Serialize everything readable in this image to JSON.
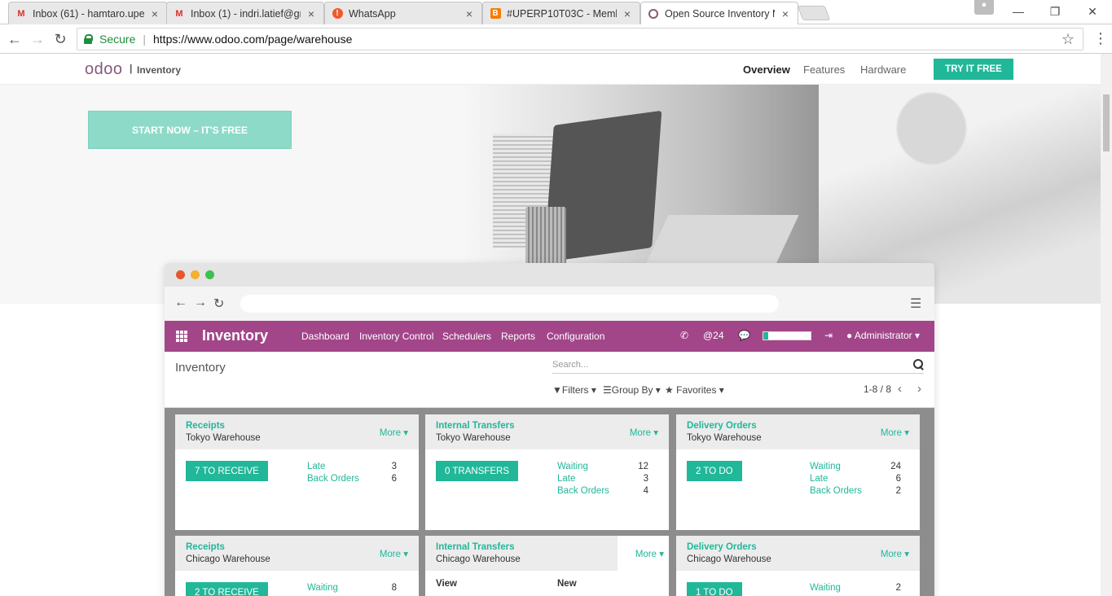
{
  "tabs": [
    {
      "title": "Inbox (61) - hamtaro.upe",
      "icon": "gmail-icon"
    },
    {
      "title": "Inbox (1) - indri.latief@gr",
      "icon": "gmail-icon"
    },
    {
      "title": "WhatsApp",
      "icon": "whatsapp-icon"
    },
    {
      "title": "#UPERP10T03C - Memb",
      "icon": "blogger-icon"
    },
    {
      "title": "Open Source Inventory M",
      "icon": "odoo-icon"
    }
  ],
  "address": {
    "secure_label": "Secure",
    "url": "https://www.odoo.com/page/warehouse"
  },
  "site": {
    "logo": "odoo",
    "app_sep": "|",
    "app": "Inventory",
    "nav": [
      "Overview",
      "Features",
      "Hardware"
    ],
    "try_label": "TRY IT FREE",
    "start_label": "START NOW – IT'S FREE"
  },
  "odoo": {
    "brand": "Inventory",
    "menu": [
      "Dashboard",
      "Inventory Control",
      "Schedulers",
      "Reports",
      "Configuration"
    ],
    "mentions": "@24",
    "user": "Administrator",
    "progress": 0.1,
    "view_title": "Inventory",
    "search_placeholder": "Search...",
    "filters": "Filters",
    "group_by": "Group By",
    "favorites": "Favorites",
    "pager": "1-8 / 8"
  },
  "cards": [
    {
      "name": "Receipts",
      "warehouse": "Tokyo Warehouse",
      "more": "More",
      "button": "7 TO RECEIVE",
      "rows": [
        {
          "label": "Late",
          "value": "3"
        },
        {
          "label": "Back Orders",
          "value": "6"
        }
      ]
    },
    {
      "name": "Internal Transfers",
      "warehouse": "Tokyo Warehouse",
      "more": "More",
      "button": "0 TRANSFERS",
      "rows": [
        {
          "label": "Waiting",
          "value": "12"
        },
        {
          "label": "Late",
          "value": "3"
        },
        {
          "label": "Back Orders",
          "value": "4"
        }
      ]
    },
    {
      "name": "Delivery Orders",
      "warehouse": "Tokyo Warehouse",
      "more": "More",
      "button": "2 TO DO",
      "rows": [
        {
          "label": "Waiting",
          "value": "24"
        },
        {
          "label": "Late",
          "value": "6"
        },
        {
          "label": "Back Orders",
          "value": "2"
        }
      ]
    },
    {
      "name": "Receipts",
      "warehouse": "Chicago Warehouse",
      "more": "More",
      "button": "2 TO RECEIVE",
      "rows": [
        {
          "label": "Waiting",
          "value": "8"
        }
      ]
    },
    {
      "name": "Internal Transfers",
      "warehouse": "Chicago Warehouse",
      "more": "More",
      "dropdown": {
        "view": "View",
        "new": "New"
      }
    },
    {
      "name": "Delivery Orders",
      "warehouse": "Chicago Warehouse",
      "more": "More",
      "button": "1 TO DO",
      "rows": [
        {
          "label": "Waiting",
          "value": "2"
        }
      ]
    }
  ]
}
